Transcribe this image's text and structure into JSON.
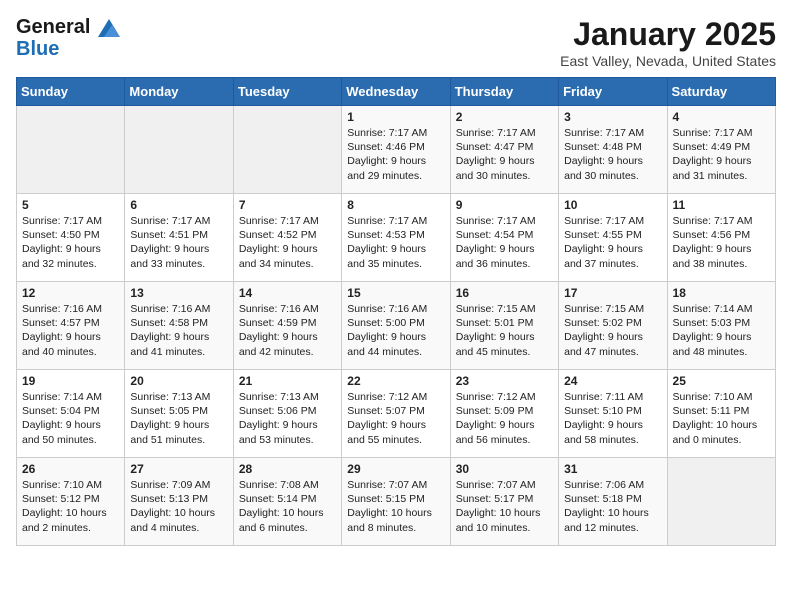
{
  "header": {
    "logo_line1": "General",
    "logo_line2": "Blue",
    "month_title": "January 2025",
    "location": "East Valley, Nevada, United States"
  },
  "weekdays": [
    "Sunday",
    "Monday",
    "Tuesday",
    "Wednesday",
    "Thursday",
    "Friday",
    "Saturday"
  ],
  "weeks": [
    [
      {
        "day": "",
        "sunrise": "",
        "sunset": "",
        "daylight": ""
      },
      {
        "day": "",
        "sunrise": "",
        "sunset": "",
        "daylight": ""
      },
      {
        "day": "",
        "sunrise": "",
        "sunset": "",
        "daylight": ""
      },
      {
        "day": "1",
        "sunrise": "Sunrise: 7:17 AM",
        "sunset": "Sunset: 4:46 PM",
        "daylight": "Daylight: 9 hours and 29 minutes."
      },
      {
        "day": "2",
        "sunrise": "Sunrise: 7:17 AM",
        "sunset": "Sunset: 4:47 PM",
        "daylight": "Daylight: 9 hours and 30 minutes."
      },
      {
        "day": "3",
        "sunrise": "Sunrise: 7:17 AM",
        "sunset": "Sunset: 4:48 PM",
        "daylight": "Daylight: 9 hours and 30 minutes."
      },
      {
        "day": "4",
        "sunrise": "Sunrise: 7:17 AM",
        "sunset": "Sunset: 4:49 PM",
        "daylight": "Daylight: 9 hours and 31 minutes."
      }
    ],
    [
      {
        "day": "5",
        "sunrise": "Sunrise: 7:17 AM",
        "sunset": "Sunset: 4:50 PM",
        "daylight": "Daylight: 9 hours and 32 minutes."
      },
      {
        "day": "6",
        "sunrise": "Sunrise: 7:17 AM",
        "sunset": "Sunset: 4:51 PM",
        "daylight": "Daylight: 9 hours and 33 minutes."
      },
      {
        "day": "7",
        "sunrise": "Sunrise: 7:17 AM",
        "sunset": "Sunset: 4:52 PM",
        "daylight": "Daylight: 9 hours and 34 minutes."
      },
      {
        "day": "8",
        "sunrise": "Sunrise: 7:17 AM",
        "sunset": "Sunset: 4:53 PM",
        "daylight": "Daylight: 9 hours and 35 minutes."
      },
      {
        "day": "9",
        "sunrise": "Sunrise: 7:17 AM",
        "sunset": "Sunset: 4:54 PM",
        "daylight": "Daylight: 9 hours and 36 minutes."
      },
      {
        "day": "10",
        "sunrise": "Sunrise: 7:17 AM",
        "sunset": "Sunset: 4:55 PM",
        "daylight": "Daylight: 9 hours and 37 minutes."
      },
      {
        "day": "11",
        "sunrise": "Sunrise: 7:17 AM",
        "sunset": "Sunset: 4:56 PM",
        "daylight": "Daylight: 9 hours and 38 minutes."
      }
    ],
    [
      {
        "day": "12",
        "sunrise": "Sunrise: 7:16 AM",
        "sunset": "Sunset: 4:57 PM",
        "daylight": "Daylight: 9 hours and 40 minutes."
      },
      {
        "day": "13",
        "sunrise": "Sunrise: 7:16 AM",
        "sunset": "Sunset: 4:58 PM",
        "daylight": "Daylight: 9 hours and 41 minutes."
      },
      {
        "day": "14",
        "sunrise": "Sunrise: 7:16 AM",
        "sunset": "Sunset: 4:59 PM",
        "daylight": "Daylight: 9 hours and 42 minutes."
      },
      {
        "day": "15",
        "sunrise": "Sunrise: 7:16 AM",
        "sunset": "Sunset: 5:00 PM",
        "daylight": "Daylight: 9 hours and 44 minutes."
      },
      {
        "day": "16",
        "sunrise": "Sunrise: 7:15 AM",
        "sunset": "Sunset: 5:01 PM",
        "daylight": "Daylight: 9 hours and 45 minutes."
      },
      {
        "day": "17",
        "sunrise": "Sunrise: 7:15 AM",
        "sunset": "Sunset: 5:02 PM",
        "daylight": "Daylight: 9 hours and 47 minutes."
      },
      {
        "day": "18",
        "sunrise": "Sunrise: 7:14 AM",
        "sunset": "Sunset: 5:03 PM",
        "daylight": "Daylight: 9 hours and 48 minutes."
      }
    ],
    [
      {
        "day": "19",
        "sunrise": "Sunrise: 7:14 AM",
        "sunset": "Sunset: 5:04 PM",
        "daylight": "Daylight: 9 hours and 50 minutes."
      },
      {
        "day": "20",
        "sunrise": "Sunrise: 7:13 AM",
        "sunset": "Sunset: 5:05 PM",
        "daylight": "Daylight: 9 hours and 51 minutes."
      },
      {
        "day": "21",
        "sunrise": "Sunrise: 7:13 AM",
        "sunset": "Sunset: 5:06 PM",
        "daylight": "Daylight: 9 hours and 53 minutes."
      },
      {
        "day": "22",
        "sunrise": "Sunrise: 7:12 AM",
        "sunset": "Sunset: 5:07 PM",
        "daylight": "Daylight: 9 hours and 55 minutes."
      },
      {
        "day": "23",
        "sunrise": "Sunrise: 7:12 AM",
        "sunset": "Sunset: 5:09 PM",
        "daylight": "Daylight: 9 hours and 56 minutes."
      },
      {
        "day": "24",
        "sunrise": "Sunrise: 7:11 AM",
        "sunset": "Sunset: 5:10 PM",
        "daylight": "Daylight: 9 hours and 58 minutes."
      },
      {
        "day": "25",
        "sunrise": "Sunrise: 7:10 AM",
        "sunset": "Sunset: 5:11 PM",
        "daylight": "Daylight: 10 hours and 0 minutes."
      }
    ],
    [
      {
        "day": "26",
        "sunrise": "Sunrise: 7:10 AM",
        "sunset": "Sunset: 5:12 PM",
        "daylight": "Daylight: 10 hours and 2 minutes."
      },
      {
        "day": "27",
        "sunrise": "Sunrise: 7:09 AM",
        "sunset": "Sunset: 5:13 PM",
        "daylight": "Daylight: 10 hours and 4 minutes."
      },
      {
        "day": "28",
        "sunrise": "Sunrise: 7:08 AM",
        "sunset": "Sunset: 5:14 PM",
        "daylight": "Daylight: 10 hours and 6 minutes."
      },
      {
        "day": "29",
        "sunrise": "Sunrise: 7:07 AM",
        "sunset": "Sunset: 5:15 PM",
        "daylight": "Daylight: 10 hours and 8 minutes."
      },
      {
        "day": "30",
        "sunrise": "Sunrise: 7:07 AM",
        "sunset": "Sunset: 5:17 PM",
        "daylight": "Daylight: 10 hours and 10 minutes."
      },
      {
        "day": "31",
        "sunrise": "Sunrise: 7:06 AM",
        "sunset": "Sunset: 5:18 PM",
        "daylight": "Daylight: 10 hours and 12 minutes."
      },
      {
        "day": "",
        "sunrise": "",
        "sunset": "",
        "daylight": ""
      }
    ]
  ]
}
